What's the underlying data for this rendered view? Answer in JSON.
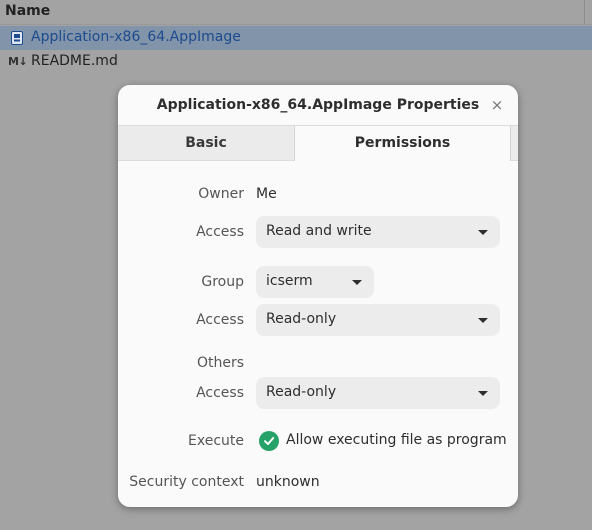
{
  "file_manager": {
    "column_name": "Name",
    "rows": [
      {
        "name": "Application-x86_64.AppImage",
        "icon": "executable-file-icon",
        "selected": true
      },
      {
        "name": "README.md",
        "icon": "markdown-file-icon",
        "badge": "M↓",
        "selected": false
      }
    ]
  },
  "dialog": {
    "title": "Application-x86_64.AppImage Properties",
    "close_glyph": "×",
    "tabs": [
      {
        "label": "Basic",
        "active": false
      },
      {
        "label": "Permissions",
        "active": true
      }
    ],
    "owner": {
      "label": "Owner",
      "value": "Me",
      "access_label": "Access",
      "access_value": "Read and write"
    },
    "group": {
      "label": "Group",
      "value": "icserm",
      "access_label": "Access",
      "access_value": "Read-only"
    },
    "others": {
      "label": "Others",
      "access_label": "Access",
      "access_value": "Read-only"
    },
    "execute": {
      "label": "Execute",
      "option": "Allow executing file as program",
      "checked": true
    },
    "security": {
      "label": "Security context",
      "value": "unknown"
    }
  },
  "colors": {
    "accent_check": "#26a269",
    "selection": "#8294a9",
    "link_text": "#1c4b8f"
  }
}
